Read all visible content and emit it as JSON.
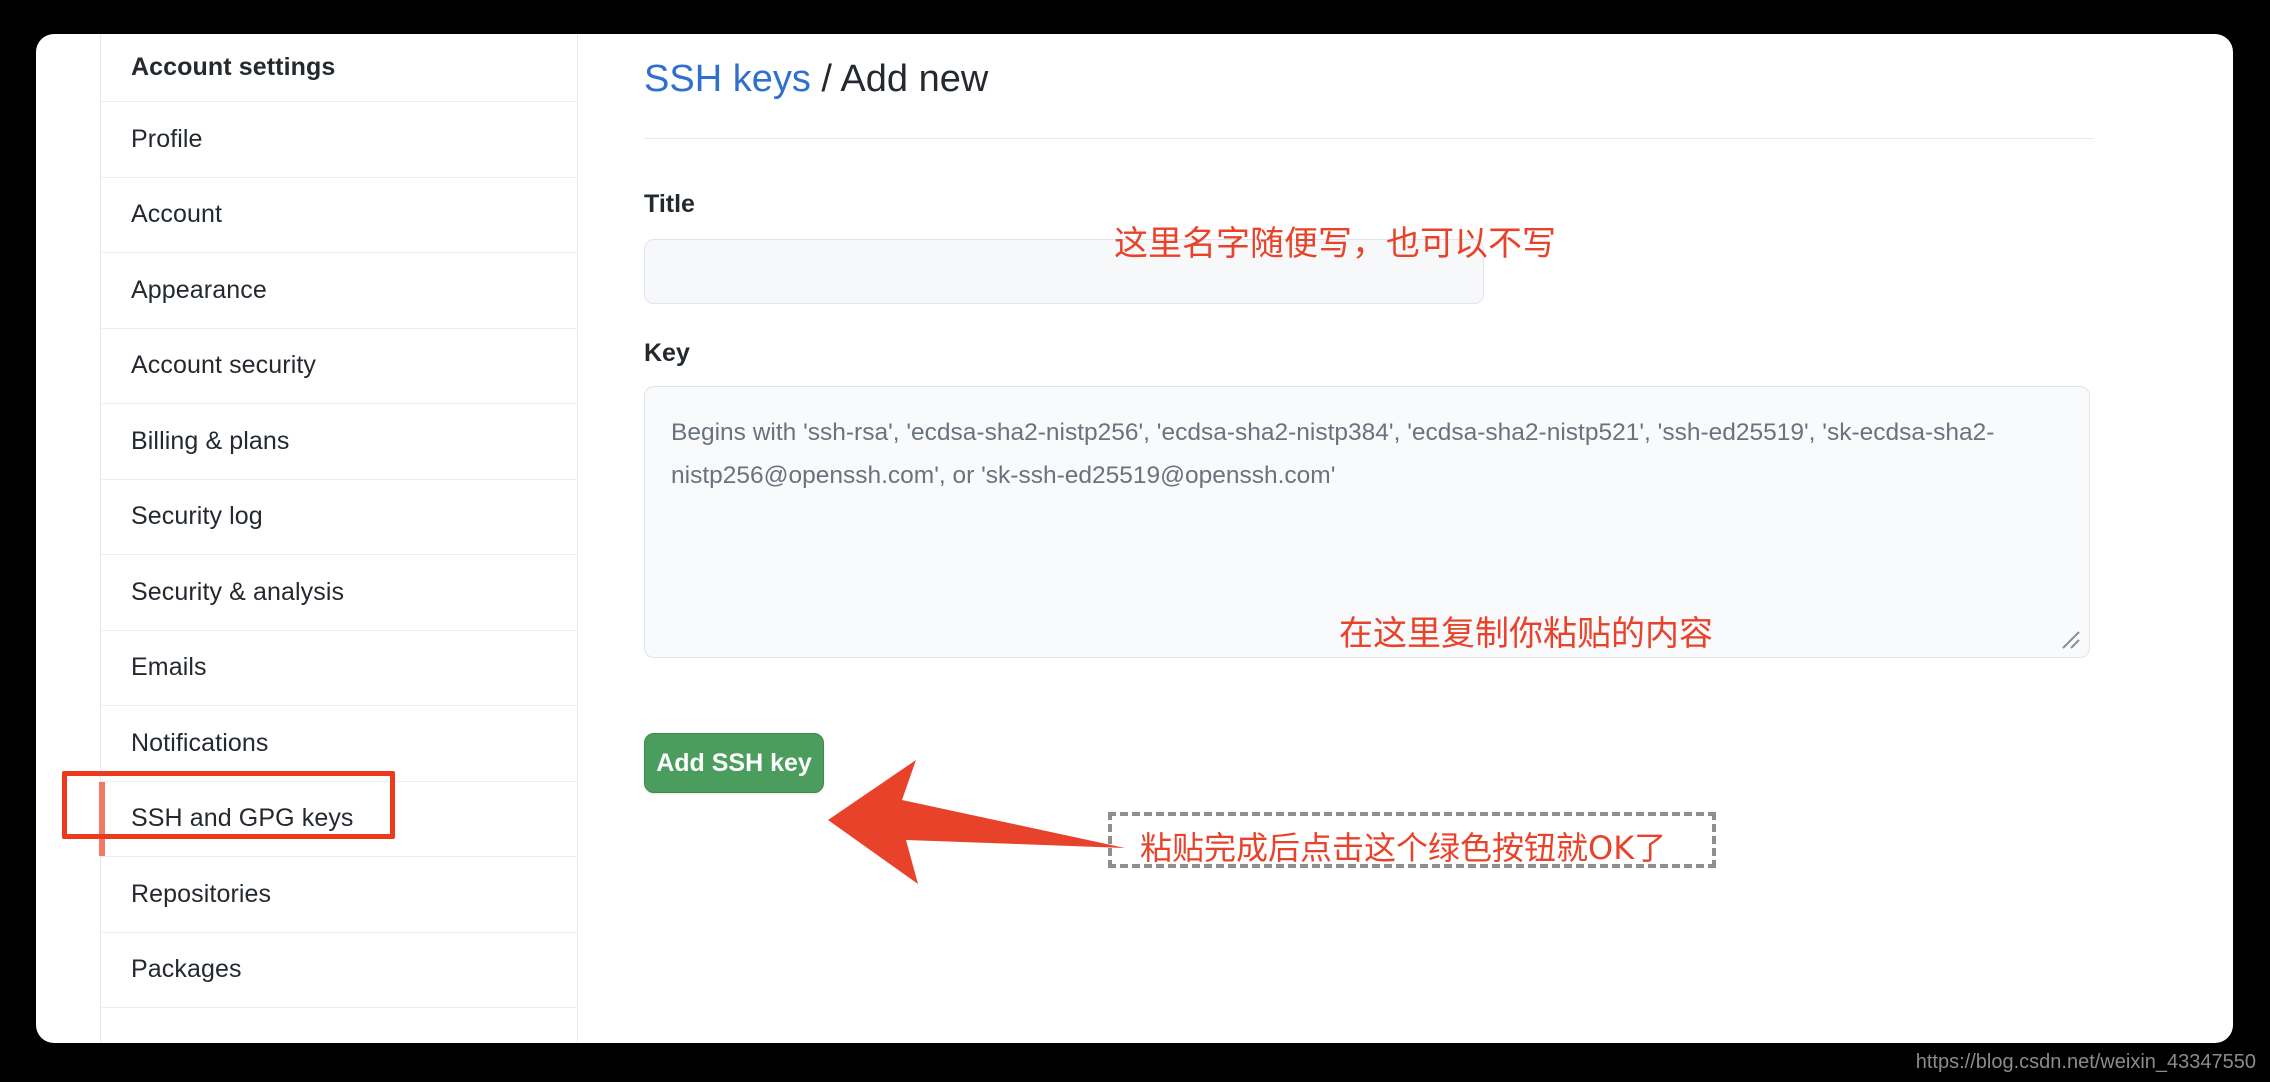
{
  "window": {
    "background_color": "#000000",
    "page_background": "#ffffff"
  },
  "sidebar": {
    "header_label": "Account settings",
    "selected_item": "SSH and GPG keys",
    "selection_bar_color": "#f07a66",
    "items": [
      {
        "label": "Profile"
      },
      {
        "label": "Account"
      },
      {
        "label": "Appearance"
      },
      {
        "label": "Account security"
      },
      {
        "label": "Billing & plans"
      },
      {
        "label": "Security log"
      },
      {
        "label": "Security & analysis"
      },
      {
        "label": "Emails"
      },
      {
        "label": "Notifications"
      },
      {
        "label": "SSH and GPG keys"
      },
      {
        "label": "Repositories"
      },
      {
        "label": "Packages"
      }
    ]
  },
  "main": {
    "breadcrumb": {
      "link_label": "SSH keys",
      "separator": "/",
      "current_label": "Add new",
      "link_color": "#2f6fd0"
    },
    "title_field": {
      "label": "Title",
      "value": "",
      "placeholder": ""
    },
    "key_field": {
      "label": "Key",
      "value": "",
      "placeholder": "Begins with 'ssh-rsa', 'ecdsa-sha2-nistp256', 'ecdsa-sha2-nistp384', 'ecdsa-sha2-nistp521', 'ssh-ed25519', 'sk-ecdsa-sha2-nistp256@openssh.com', or 'sk-ssh-ed25519@openssh.com'"
    },
    "submit_button": {
      "label": "Add SSH key",
      "color": "#4a9d5c"
    }
  },
  "annotations": {
    "color": "#e8432a",
    "title_note": "这里名字随便写，也可以不写",
    "key_note": "在这里复制你粘贴的内容",
    "button_note": "粘贴完成后点击这个绿色按钮就OK了",
    "sidebar_box_color": "#ec3a1c",
    "arrow_color": "#e8432a",
    "dashed_box_color": "#8f8f8f"
  },
  "watermark": {
    "text": "https://blog.csdn.net/weixin_43347550"
  }
}
